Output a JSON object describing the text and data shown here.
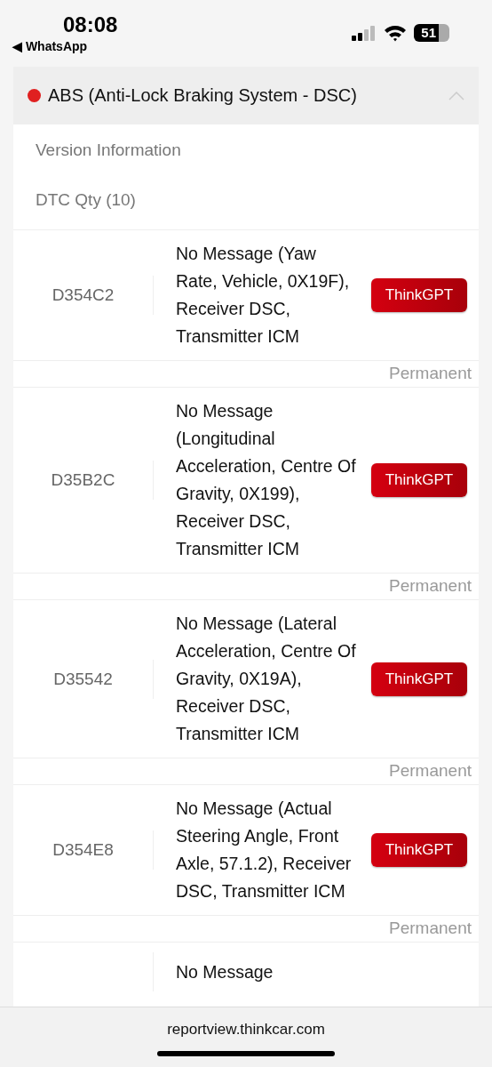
{
  "status_bar": {
    "time": "08:08",
    "back_label": "◀ WhatsApp",
    "battery": "51"
  },
  "section": {
    "title": "ABS (Anti-Lock Braking System - DSC)",
    "color": "#e02020",
    "expanded": true
  },
  "version_label": "Version Information",
  "dtc_qty": "DTC Qty (10)",
  "dtcs": [
    {
      "code": "D354C2",
      "description": "No Message (Yaw Rate, Vehicle, 0X19F), Receiver DSC, Transmitter ICM",
      "button": "ThinkGPT",
      "status": "Permanent"
    },
    {
      "code": "D35B2C",
      "description": "No Message (Longitudinal Acceleration, Centre Of Gravity, 0X199), Receiver DSC, Transmitter ICM",
      "button": "ThinkGPT",
      "status": "Permanent"
    },
    {
      "code": "D35542",
      "description": "No Message (Lateral Acceleration, Centre Of Gravity, 0X19A), Receiver DSC, Transmitter ICM",
      "button": "ThinkGPT",
      "status": "Permanent"
    },
    {
      "code": "D354E8",
      "description": "No Message (Actual Steering Angle, Front Axle, 57.1.2), Receiver DSC, Transmitter ICM",
      "button": "ThinkGPT",
      "status": "Permanent"
    },
    {
      "description": "No Message"
    }
  ],
  "address_bar": {
    "url": "reportview.thinkcar.com"
  }
}
